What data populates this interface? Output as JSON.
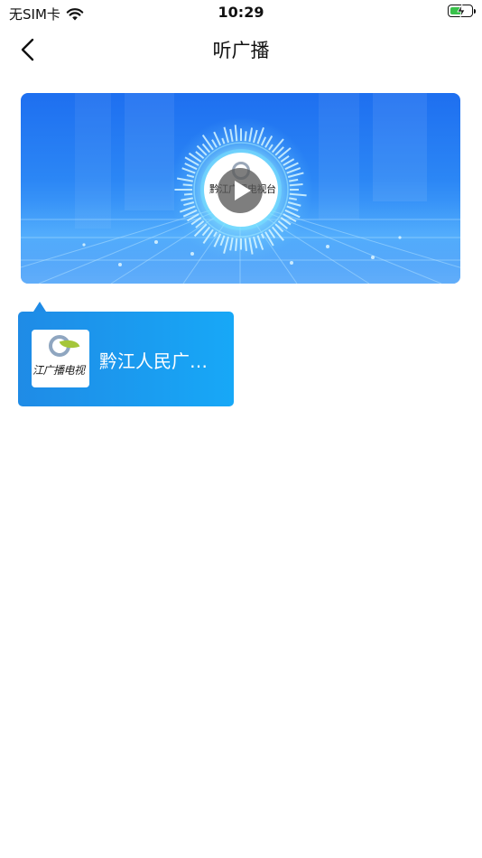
{
  "status_bar": {
    "carrier": "无SIM卡",
    "time": "10:29",
    "wifi_icon": "wifi-icon",
    "battery_icon": "battery-charging-icon"
  },
  "nav": {
    "back_icon": "chevron-left-icon",
    "title": "听广播"
  },
  "banner": {
    "logo_text": "黔江广播电视台",
    "play_icon": "play-icon"
  },
  "station": {
    "name": "黔江人民广播电台",
    "logo_text": "江广播电视",
    "accent": "#17a8f7"
  }
}
